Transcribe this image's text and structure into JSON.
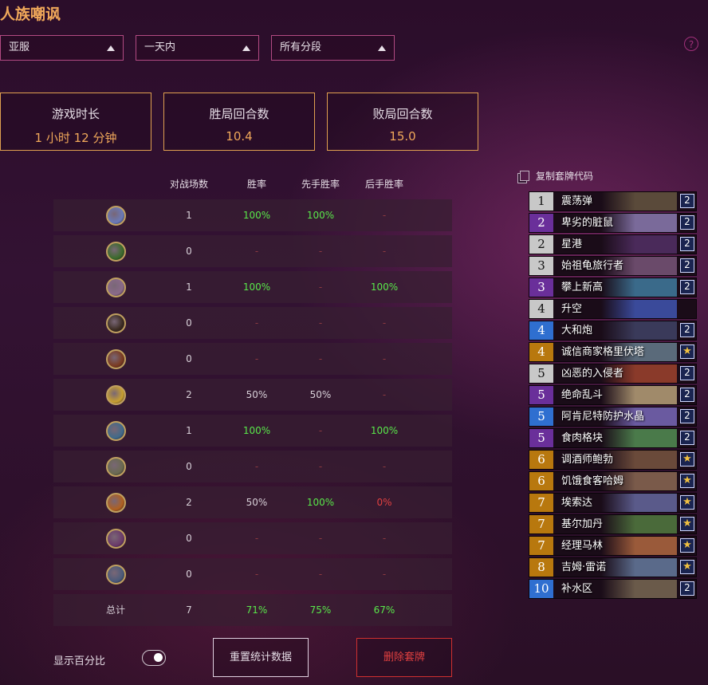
{
  "title": "人族嘲讽",
  "help_icon": "?",
  "filters": [
    {
      "value": "亚服"
    },
    {
      "value": "一天内"
    },
    {
      "value": "所有分段"
    }
  ],
  "stats": [
    {
      "label": "游戏时长",
      "value": "1 小时 12 分钟"
    },
    {
      "label": "胜局回合数",
      "value": "10.4"
    },
    {
      "label": "败局回合数",
      "value": "15.0"
    }
  ],
  "table": {
    "headers": [
      "对战场数",
      "胜率",
      "先手胜率",
      "后手胜率"
    ],
    "rows": [
      {
        "icon": "warrior-class-icon",
        "color": "#6a7ab8",
        "games": "1",
        "winrate": "100%",
        "first": "100%",
        "second": "-",
        "wc": "g",
        "fc": "g",
        "sc": "d"
      },
      {
        "icon": "druid-class-icon",
        "color": "#3a6a2a",
        "games": "0",
        "winrate": "-",
        "first": "-",
        "second": "-",
        "wc": "d",
        "fc": "d",
        "sc": "d"
      },
      {
        "icon": "mage-class-icon",
        "color": "#8a6a8a",
        "games": "1",
        "winrate": "100%",
        "first": "-",
        "second": "100%",
        "wc": "g",
        "fc": "d",
        "sc": "g"
      },
      {
        "icon": "rogue-class-icon",
        "color": "#3a2a20",
        "games": "0",
        "winrate": "-",
        "first": "-",
        "second": "-",
        "wc": "d",
        "fc": "d",
        "sc": "d"
      },
      {
        "icon": "hunter-class-icon",
        "color": "#7a3a20",
        "games": "0",
        "winrate": "-",
        "first": "-",
        "second": "-",
        "wc": "d",
        "fc": "d",
        "sc": "d"
      },
      {
        "icon": "paladin-class-icon",
        "color": "#c8a030",
        "games": "2",
        "winrate": "50%",
        "first": "50%",
        "second": "-",
        "wc": "w",
        "fc": "w",
        "sc": "d"
      },
      {
        "icon": "shaman-class-icon",
        "color": "#406a8a",
        "games": "1",
        "winrate": "100%",
        "first": "-",
        "second": "100%",
        "wc": "g",
        "fc": "d",
        "sc": "g"
      },
      {
        "icon": "priest-class-icon",
        "color": "#6a6a50",
        "games": "0",
        "winrate": "-",
        "first": "-",
        "second": "-",
        "wc": "d",
        "fc": "d",
        "sc": "d"
      },
      {
        "icon": "warlock-class-icon",
        "color": "#b06020",
        "games": "2",
        "winrate": "50%",
        "first": "100%",
        "second": "0%",
        "wc": "w",
        "fc": "g",
        "sc": "r"
      },
      {
        "icon": "demonhunter-class-icon",
        "color": "#6a3a6a",
        "games": "0",
        "winrate": "-",
        "first": "-",
        "second": "-",
        "wc": "d",
        "fc": "d",
        "sc": "d"
      },
      {
        "icon": "deathknight-class-icon",
        "color": "#4a5a7a",
        "games": "0",
        "winrate": "-",
        "first": "-",
        "second": "-",
        "wc": "d",
        "fc": "d",
        "sc": "d"
      }
    ],
    "total": {
      "label": "总计",
      "games": "7",
      "winrate": "71%",
      "first": "75%",
      "second": "67%"
    }
  },
  "copy_deck_label": "复制套牌代码",
  "cards": [
    {
      "cost": "1",
      "name": "震荡弹",
      "count": "2",
      "rarity": "common",
      "art": "#5a4a3a"
    },
    {
      "cost": "2",
      "name": "卑劣的脏鼠",
      "count": "2",
      "rarity": "epic",
      "art": "#7a6a9a"
    },
    {
      "cost": "2",
      "name": "星港",
      "count": "2",
      "rarity": "common",
      "art": "#4a2a5a"
    },
    {
      "cost": "3",
      "name": "始祖龟旅行者",
      "count": "2",
      "rarity": "common",
      "art": "#6a4a6a"
    },
    {
      "cost": "3",
      "name": "攀上新高",
      "count": "2",
      "rarity": "epic",
      "art": "#3a6a8a"
    },
    {
      "cost": "4",
      "name": "升空",
      "count": "",
      "rarity": "common",
      "art": "#3a4a9a"
    },
    {
      "cost": "4",
      "name": "大和炮",
      "count": "2",
      "rarity": "rare",
      "art": "#3a3a5a"
    },
    {
      "cost": "4",
      "name": "诚信商家格里伏塔",
      "count": "★",
      "rarity": "legendary",
      "art": "#5a6a7a"
    },
    {
      "cost": "5",
      "name": "凶恶的入侵者",
      "count": "2",
      "rarity": "common",
      "art": "#8a3a2a"
    },
    {
      "cost": "5",
      "name": "绝命乱斗",
      "count": "2",
      "rarity": "epic",
      "art": "#a08a6a"
    },
    {
      "cost": "5",
      "name": "阿肯尼特防护水晶",
      "count": "2",
      "rarity": "rare",
      "art": "#6a5aa0"
    },
    {
      "cost": "5",
      "name": "食肉格块",
      "count": "2",
      "rarity": "epic",
      "art": "#4a7a4a"
    },
    {
      "cost": "6",
      "name": "调酒师鲍勃",
      "count": "★",
      "rarity": "legendary",
      "art": "#6a4a3a"
    },
    {
      "cost": "6",
      "name": "饥饿食客哈姆",
      "count": "★",
      "rarity": "legendary",
      "art": "#7a5a4a"
    },
    {
      "cost": "7",
      "name": "埃索达",
      "count": "★",
      "rarity": "legendary",
      "art": "#5a5a8a"
    },
    {
      "cost": "7",
      "name": "基尔加丹",
      "count": "★",
      "rarity": "legendary",
      "art": "#4a6a3a"
    },
    {
      "cost": "7",
      "name": "经理马林",
      "count": "★",
      "rarity": "legendary",
      "art": "#9a5a3a"
    },
    {
      "cost": "8",
      "name": "吉姆·雷诺",
      "count": "★",
      "rarity": "legendary",
      "art": "#5a6a8a"
    },
    {
      "cost": "10",
      "name": "补水区",
      "count": "2",
      "rarity": "rare",
      "art": "#6a5a4a"
    }
  ],
  "rarity_colors": {
    "common": "#c8c8c8",
    "rare": "#2f6fd0",
    "epic": "#6a2f9a",
    "legendary": "#b8780e"
  },
  "show_percent_label": "显示百分比",
  "reset_label": "重置统计数据",
  "delete_label": "删除套牌"
}
